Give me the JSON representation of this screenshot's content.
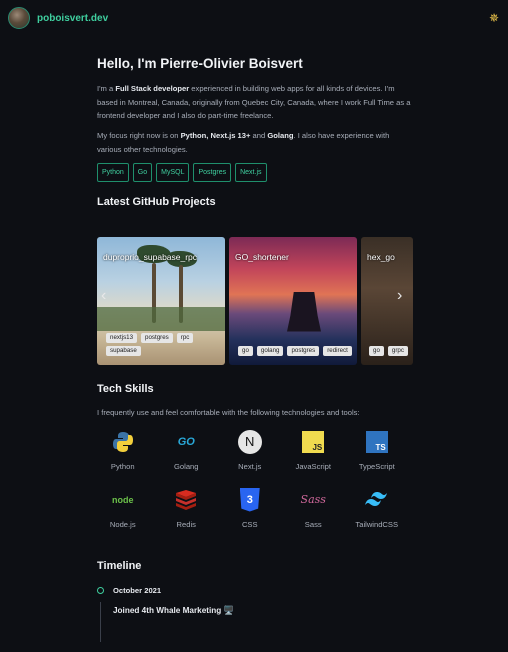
{
  "header": {
    "brand": "poboisvert.dev",
    "theme_icon": "sun-icon",
    "theme_glyph": "✵"
  },
  "hero": {
    "heading": "Hello, I'm Pierre-Olivier Boisvert",
    "p1_a": "I'm a ",
    "p1_b": "Full Stack developer",
    "p1_c": " experienced in building web apps for all kinds of devices. I'm based in Montreal, Canada, originally from Quebec City, Canada, where I work Full Time as a frontend developer and I also do part-time freelance.",
    "p2_a": "My focus right now is on ",
    "p2_b": "Python, Next.js 13+",
    "p2_c": " and ",
    "p2_d": "Golang",
    "p2_e": ". I also have experience with various other technologies.",
    "tags": [
      "Python",
      "Go",
      "MySQL",
      "Postgres",
      "Next.js"
    ]
  },
  "projects": {
    "heading": "Latest GitHub Projects",
    "prev_glyph": "‹",
    "next_glyph": "›",
    "cards": [
      {
        "title": "duproprio_supabase_rpc",
        "chips": [
          "nextjs13",
          "postgres",
          "rpc",
          "supabase"
        ]
      },
      {
        "title": "GO_shortener",
        "chips": [
          "go",
          "golang",
          "postgres",
          "redirect"
        ]
      },
      {
        "title": "hex_go",
        "chips": [
          "go",
          "grpc"
        ]
      }
    ]
  },
  "skills": {
    "heading": "Tech Skills",
    "intro": "I frequently use and feel comfortable with the following technologies and tools:",
    "items": [
      {
        "label": "Python",
        "icon": "python-icon"
      },
      {
        "label": "Golang",
        "icon": "golang-icon"
      },
      {
        "label": "Next.js",
        "icon": "nextjs-icon"
      },
      {
        "label": "JavaScript",
        "icon": "javascript-icon"
      },
      {
        "label": "TypeScript",
        "icon": "typescript-icon"
      },
      {
        "label": "Node.js",
        "icon": "nodejs-icon"
      },
      {
        "label": "Redis",
        "icon": "redis-icon"
      },
      {
        "label": "CSS",
        "icon": "css-icon"
      },
      {
        "label": "Sass",
        "icon": "sass-icon"
      },
      {
        "label": "TailwindCSS",
        "icon": "tailwindcss-icon"
      }
    ],
    "icon_text": {
      "go": "GO",
      "n": "N",
      "js": "JS",
      "ts": "TS",
      "node": "node",
      "css": "3",
      "sass": "Sass"
    }
  },
  "timeline": {
    "heading": "Timeline",
    "entries": [
      {
        "date": "October 2021",
        "title": "Joined 4th Whale Marketing 🖥️"
      }
    ]
  },
  "colors": {
    "accent": "#3fcf9f",
    "background": "#0d0f14",
    "heading": "#f1f3f6"
  }
}
